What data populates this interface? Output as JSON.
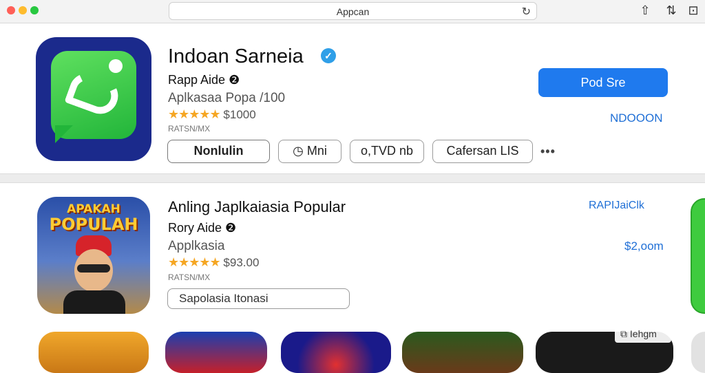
{
  "window": {
    "url_text": "Appcan",
    "reload_icon": "reload-icon",
    "toolbar_icons": [
      "share-icon",
      "tabs-icon",
      "sidebar-icon"
    ],
    "traffic_colors": {
      "close": "#ff5f57",
      "minimize": "#febc2e",
      "zoom": "#28c840"
    }
  },
  "featured": {
    "title": "Indoan Sarneia",
    "developer": "Rapp Aide",
    "category": "Aplkasaa Popa /100",
    "stars": "★★★★★",
    "rating_text": "$1000",
    "sub": "RATSN/MX",
    "primary_button": "Pod Sre",
    "link": "NDOOON",
    "pills": [
      "Nonlulin",
      "Mni",
      "o,TVD nb",
      "Cafersan LIS"
    ],
    "more": "•••",
    "accent": "#1f7aee"
  },
  "second": {
    "icon_text_top": "APAKAH",
    "icon_text_main": "POPULAH",
    "title": "Anling Japlkaiasia Popular",
    "developer": "Rory Aide",
    "category": "Applkasia",
    "stars": "★★★★★",
    "rating_text": "$93.00",
    "sub": "RATSN/MX",
    "pill": "Sapolasia Itonasi",
    "link": "RAPIJaiClk",
    "price": "$2,oom"
  },
  "bottom_overlay": "Iehgm"
}
